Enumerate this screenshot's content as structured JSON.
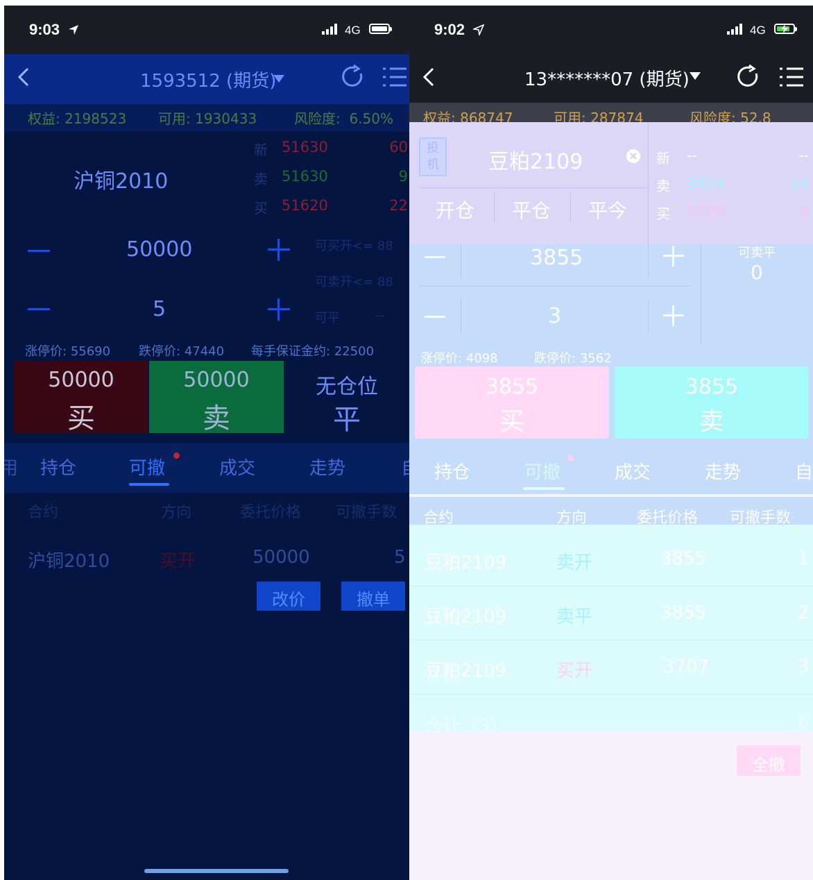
{
  "left": {
    "status": {
      "time": "9:03",
      "network": "4G"
    },
    "nav": {
      "title": "1593512 (期货)"
    },
    "account": {
      "equity_label": "权益:",
      "equity": "2198523",
      "available_label": "可用:",
      "available": "1930433",
      "risk_label": "风险度:",
      "risk": "6.50%"
    },
    "contract": {
      "name": "沪铜2010"
    },
    "quote": [
      {
        "label": "新",
        "price": "51630",
        "qty": "60"
      },
      {
        "label": "卖",
        "price": "51630",
        "qty": "9"
      },
      {
        "label": "买",
        "price": "51620",
        "qty": "22"
      }
    ],
    "order": {
      "price": "50000",
      "qty": "5",
      "buy_open_limit": "可买开<= 88",
      "sell_open_limit": "可卖开<= 88",
      "close_label": "可平",
      "close_value": "--"
    },
    "limits": {
      "up_label": "涨停价:",
      "up": "55690",
      "down_label": "跌停价:",
      "down": "47440",
      "margin_label": "每手保证金约:",
      "margin": "22500"
    },
    "actions": {
      "buy_price": "50000",
      "buy_label": "买",
      "sell_price": "50000",
      "sell_label": "卖",
      "flat_top": "无仓位",
      "flat_label": "平"
    },
    "tabs": [
      "持仓",
      "可撤",
      "成交",
      "走势",
      "自"
    ],
    "tab_left_edge": "用",
    "table": {
      "headers": [
        "合约",
        "方向",
        "委托价格",
        "可撤手数"
      ],
      "row": {
        "contract": "沪铜2010",
        "direction": "买开",
        "price": "50000",
        "qty": "5"
      },
      "modify_button": "改价",
      "cancel_button": "撤单"
    },
    "colors": {
      "bg": "#031540",
      "accent": "#1a5cff",
      "buy": "#4a0612",
      "sell": "#0a6b3c",
      "red": "#c0263a",
      "green": "#1f8a40"
    }
  },
  "right": {
    "status": {
      "time": "9:02",
      "network": "4G"
    },
    "nav": {
      "title": "13*******07 (期货)"
    },
    "account": {
      "equity_label": "权益:",
      "equity": "868747",
      "available_label": "可用:",
      "available": "287874",
      "risk_label": "风险度:",
      "risk": "52.8"
    },
    "contract": {
      "badge": "投机",
      "name": "豆粕2109"
    },
    "modes": [
      "开仓",
      "平仓",
      "平今"
    ],
    "quote": [
      {
        "label": "新",
        "price": "--",
        "qty": "--"
      },
      {
        "label": "卖",
        "price": "3824",
        "qty": "14"
      },
      {
        "label": "买",
        "price": "3728",
        "qty": "1"
      }
    ],
    "order": {
      "price": "3855",
      "qty": "3",
      "sell_close_label": "可卖平",
      "sell_close_value": "0"
    },
    "limits": {
      "up_label": "涨停价:",
      "up": "4098",
      "down_label": "跌停价:",
      "down": "3562"
    },
    "actions": {
      "buy_price": "3855",
      "buy_label": "买",
      "sell_price": "3855",
      "sell_label": "卖"
    },
    "tabs": [
      "持仓",
      "可撤",
      "成交",
      "走势",
      "自"
    ],
    "table": {
      "headers": [
        "合约",
        "方向",
        "委托价格",
        "可撤手数"
      ],
      "rows": [
        {
          "contract": "豆粕2109",
          "direction": "卖开",
          "price": "3855",
          "qty": "1"
        },
        {
          "contract": "豆粕2109",
          "direction": "卖平",
          "price": "3855",
          "qty": "2"
        },
        {
          "contract": "豆粕2109",
          "direction": "买开",
          "price": "3707",
          "qty": "3"
        }
      ],
      "total_label": "合计（3）",
      "total_qty": "6",
      "cancel_all_button": "全撤"
    },
    "colors": {
      "lavender": "#dcd6f7",
      "blue": "#c5dcfa",
      "cyan": "#dbfbfd",
      "pink": "#ffd9f5",
      "aqua": "#a7fafa"
    }
  }
}
